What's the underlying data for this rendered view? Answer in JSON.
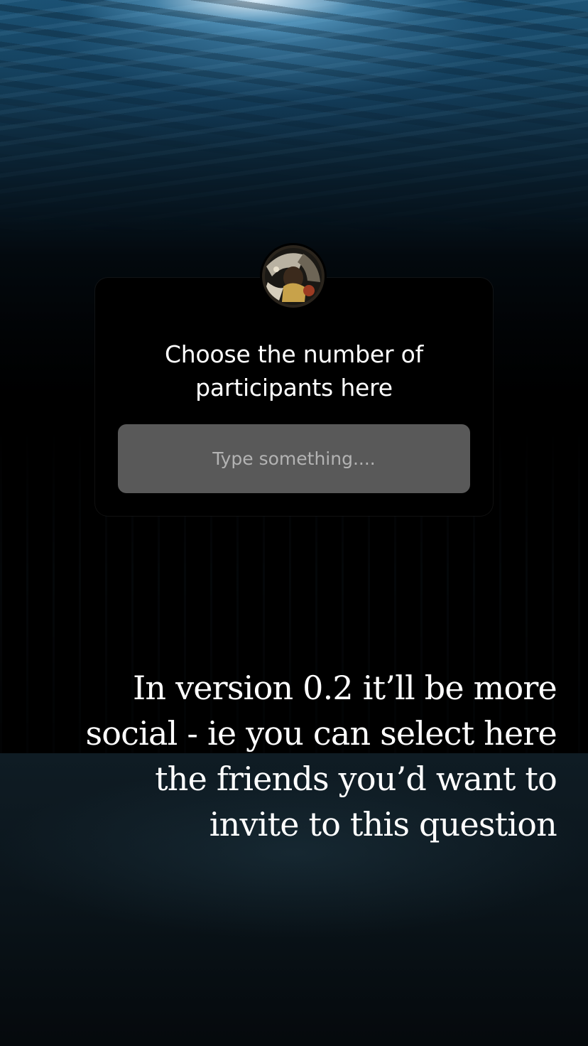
{
  "question_card": {
    "title_line1": "Choose the number of",
    "title_line2": "participants here",
    "answer_placeholder": "Type something...."
  },
  "overlay": {
    "line1": "In version 0.2 it’ll be more",
    "line2": "social - ie you can select here",
    "line3": "the friends you’d want to",
    "line4": "invite to this question"
  },
  "colors": {
    "card_background": "#000000",
    "answer_field": "#595959",
    "placeholder_text": "#b3b3b3",
    "water_surface": "#1d5475"
  }
}
